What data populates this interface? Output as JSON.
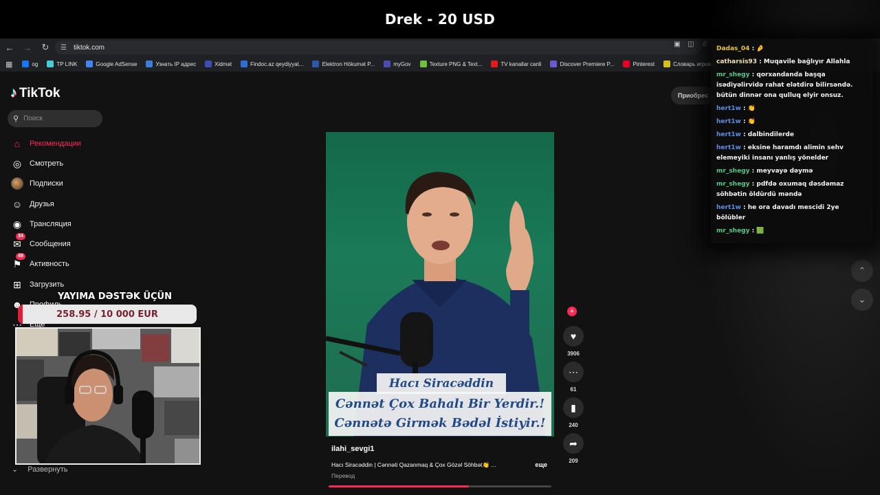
{
  "stream": {
    "title": "Drek - 20 USD"
  },
  "browser": {
    "url": "tiktok.com",
    "bookmarks": [
      {
        "label": "og",
        "color": "#1877f2"
      },
      {
        "label": "TP LINK",
        "color": "#4acbd6"
      },
      {
        "label": "Google AdSense",
        "color": "#4285f4"
      },
      {
        "label": "Узнать IP адрес",
        "color": "#3b7dd8"
      },
      {
        "label": "Xidmət",
        "color": "#3a4fb0"
      },
      {
        "label": "Findoc.az qeydiyyat...",
        "color": "#2f6fd0"
      },
      {
        "label": "Elektron Hökumət P...",
        "color": "#2d5aa8"
      },
      {
        "label": "myGov",
        "color": "#4b4bb0"
      },
      {
        "label": "Texture PNG & Text...",
        "color": "#6fbf3a"
      },
      {
        "label": "TV kanallar canli",
        "color": "#e01b1b"
      },
      {
        "label": "Discover Premiere P...",
        "color": "#6a5acd"
      },
      {
        "label": "Pinterest",
        "color": "#e60023"
      },
      {
        "label": "Словарь игровых т",
        "color": "#d4c21a"
      }
    ]
  },
  "tiktok": {
    "logo": "TikTok",
    "search_placeholder": "Поиск",
    "sidebar": [
      {
        "label": "Рекомендации",
        "icon": "home-icon",
        "active": true
      },
      {
        "label": "Смотреть",
        "icon": "compass-icon"
      },
      {
        "label": "Подписки",
        "icon": "avatar-icon"
      },
      {
        "label": "Друзья",
        "icon": "friends-icon"
      },
      {
        "label": "Трансляция",
        "icon": "live-icon"
      },
      {
        "label": "Сообщения",
        "icon": "messages-icon",
        "badge": "34"
      },
      {
        "label": "Активность",
        "icon": "activity-icon",
        "badge": "49"
      },
      {
        "label": "Загрузить",
        "icon": "upload-icon"
      },
      {
        "label": "Профиль",
        "icon": "profile-icon"
      },
      {
        "label": "Ещё",
        "icon": "more-icon"
      }
    ],
    "expand_label": "Развернуть",
    "top_pill": "Приобрес",
    "video": {
      "caption_line1": "Hacı Siracəddin",
      "caption_line2": "Cənnət Çox Bahalı Bir Yerdir.!",
      "caption_line3": "Cənnətə Girmək Bədəl İstiyir.!",
      "username": "ilahi_sevgi1",
      "description": "Hacı Siracəddin | Cənnəti Qazanmaq & Çox Gözəl Söhbət👏 ...",
      "more": "еще",
      "translate": "Перевод",
      "progress": 0.63
    },
    "actions": {
      "likes": "3906",
      "comments": "61",
      "saves": "240",
      "shares": "209"
    }
  },
  "overlay": {
    "donation_title": "YAYIMA DƏSTƏK ÜÇÜN",
    "donation_amount": "258.95 / 10 000 EUR",
    "donation_progress": 0.026
  },
  "chat": [
    {
      "nick": "Dadas_04",
      "text": "🤌",
      "color": "#e9c53c"
    },
    {
      "nick": "catharsis93",
      "text": "Muqavile bağlıyır Allahla",
      "color": "#f0e2b8"
    },
    {
      "nick": "mr_shegy",
      "text": "qorxandanda başqa isədiyəlirvidə rahat elətdirə bilirsəndə. bütün dinnər ona qulluq elyir onsuz.",
      "color": "#56c98a"
    },
    {
      "nick": "hert1w",
      "text": "👏",
      "color": "#5b8fe6"
    },
    {
      "nick": "hert1w",
      "text": "👏",
      "color": "#5b8fe6"
    },
    {
      "nick": "hert1w",
      "text": "dalbindilerde",
      "color": "#5b8fe6"
    },
    {
      "nick": "hert1w",
      "text": "eksine haramdı alimin sehv elemeyiki insanı yanlış yönelder",
      "color": "#5b8fe6"
    },
    {
      "nick": "mr_shegy",
      "text": "meyvayə dəymə",
      "color": "#56c98a"
    },
    {
      "nick": "mr_shegy",
      "text": "pdfdə oxumaq dəsdəmaz söhbətin öldürdü məndə",
      "color": "#56c98a"
    },
    {
      "nick": "hert1w",
      "text": "he ora davadı mescidi 2ye bölübler",
      "color": "#5b8fe6"
    },
    {
      "nick": "mr_shegy",
      "text": "🟩",
      "color": "#56c98a"
    }
  ]
}
